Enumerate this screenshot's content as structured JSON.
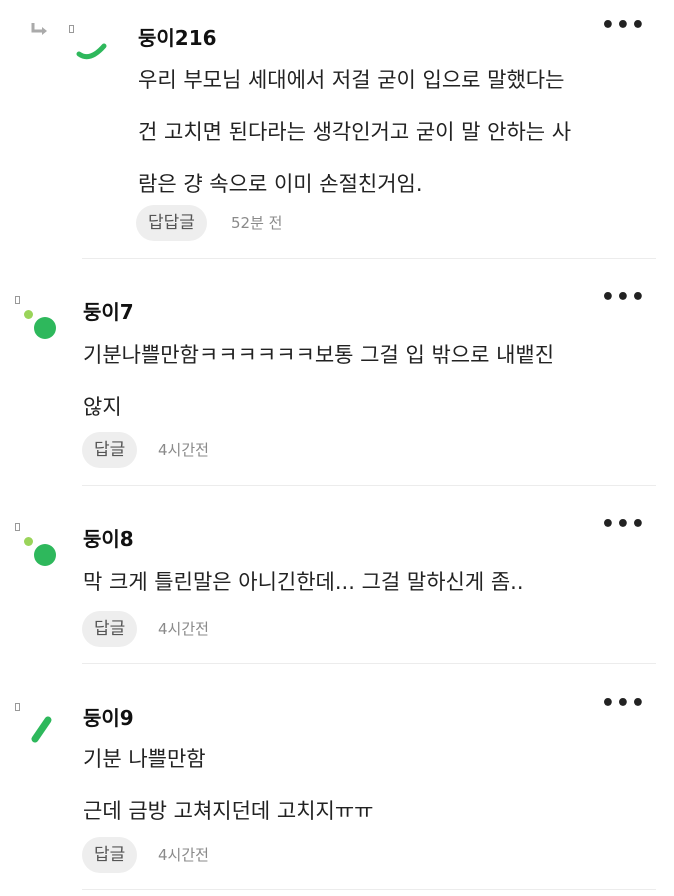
{
  "comments": [
    {
      "nickname": "둥이216",
      "lines": [
        "우리 부모님 세대에서 저걸 굳이 입으로 말했다는",
        "건 고치면 된다라는 생각인거고 굳이 말 안하는 사",
        "람은 걍 속으로 이미 손절친거임."
      ],
      "reply_label": "답답글",
      "time": "52분 전",
      "more_label": "•••"
    },
    {
      "nickname": "둥이7",
      "lines": [
        "기분나쁠만함ㅋㅋㅋㅋㅋㅋ보통 그걸 입 밖으로 내뱉진",
        "않지"
      ],
      "reply_label": "답글",
      "time": "4시간전",
      "more_label": "•••"
    },
    {
      "nickname": "둥이8",
      "lines": [
        "막 크게 틀린말은 아니긴한데... 그걸 말하신게 좀.."
      ],
      "reply_label": "답글",
      "time": "4시간전",
      "more_label": "•••"
    },
    {
      "nickname": "둥이9",
      "lines": [
        "기분 나쁠만함",
        "근데 금방 고쳐지던데 고치지ㅠㅠ"
      ],
      "reply_label": "답글",
      "time": "4시간전",
      "more_label": "•••"
    }
  ],
  "colors": {
    "accent_green": "#2eb85c",
    "light_green": "#9ad45a"
  },
  "icons": [
    "reply-arrow-icon",
    "more-options-icon",
    "avatar-icon"
  ]
}
